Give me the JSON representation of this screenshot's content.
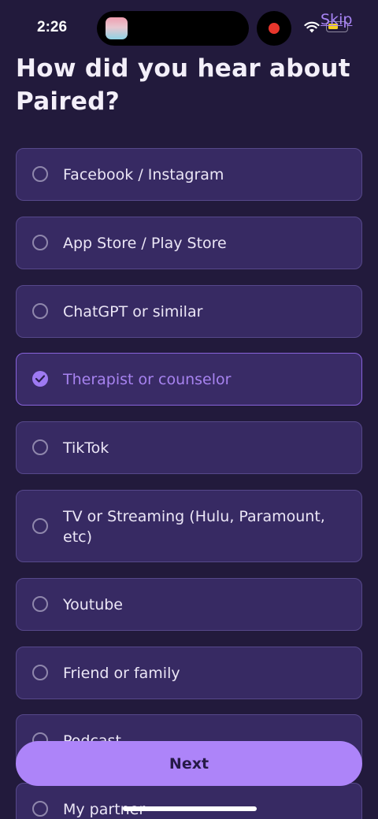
{
  "status_bar": {
    "time": "2:26"
  },
  "header": {
    "skip_label": "Skip"
  },
  "title": "How did you hear about Paired?",
  "options": [
    {
      "label": "Facebook / Instagram",
      "selected": false
    },
    {
      "label": "App Store / Play Store",
      "selected": false
    },
    {
      "label": "ChatGPT or similar",
      "selected": false
    },
    {
      "label": "Therapist or counselor",
      "selected": true
    },
    {
      "label": "TikTok",
      "selected": false
    },
    {
      "label": "TV or Streaming (Hulu, Paramount, etc)",
      "selected": false
    },
    {
      "label": "Youtube",
      "selected": false
    },
    {
      "label": "Friend or family",
      "selected": false
    },
    {
      "label": "Podcast",
      "selected": false
    },
    {
      "label": "My partner",
      "selected": false
    }
  ],
  "footer": {
    "next_label": "Next"
  },
  "colors": {
    "accent": "#ad84f9",
    "background": "#221a3c",
    "card": "#372a63"
  }
}
